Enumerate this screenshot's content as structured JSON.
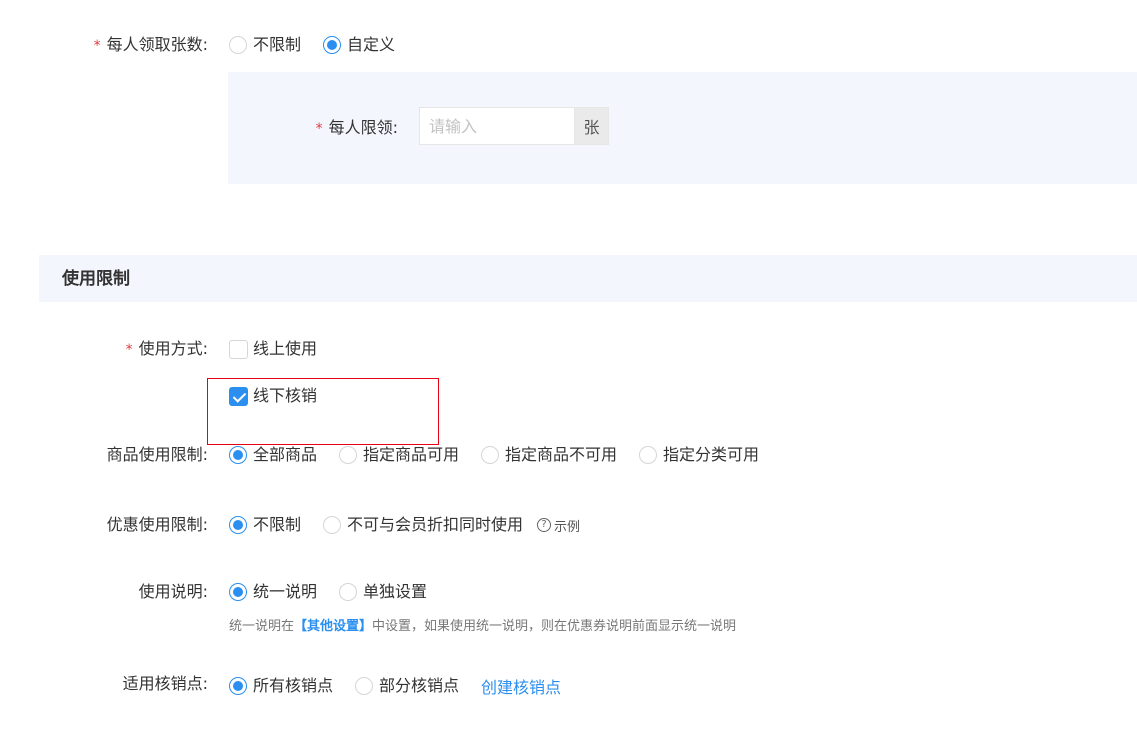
{
  "per_person_count": {
    "label": "每人领取张数:",
    "options": [
      {
        "label": "不限制",
        "checked": false
      },
      {
        "label": "自定义",
        "checked": true
      }
    ]
  },
  "per_person_limit": {
    "label": "每人限领:",
    "placeholder": "请输入",
    "value": "",
    "unit": "张"
  },
  "section_usage": {
    "title": "使用限制"
  },
  "usage_mode": {
    "label": "使用方式:",
    "options": [
      {
        "label": "线上使用",
        "checked": false
      },
      {
        "label": "线下核销",
        "checked": true
      }
    ]
  },
  "product_limit": {
    "label": "商品使用限制:",
    "options": [
      {
        "label": "全部商品",
        "checked": true
      },
      {
        "label": "指定商品可用",
        "checked": false
      },
      {
        "label": "指定商品不可用",
        "checked": false
      },
      {
        "label": "指定分类可用",
        "checked": false
      }
    ]
  },
  "discount_limit": {
    "label": "优惠使用限制:",
    "options": [
      {
        "label": "不限制",
        "checked": true
      },
      {
        "label": "不可与会员折扣同时使用",
        "checked": false
      }
    ],
    "help_label": "示例",
    "help_icon": "?"
  },
  "usage_desc": {
    "label": "使用说明:",
    "options": [
      {
        "label": "统一说明",
        "checked": true
      },
      {
        "label": "单独设置",
        "checked": false
      }
    ],
    "note_prefix": "统一说明在",
    "note_bold": "【其他设置】",
    "note_suffix": "中设置，如果使用统一说明，则在优惠券说明前面显示统一说明"
  },
  "verify_points": {
    "label": "适用核销点:",
    "options": [
      {
        "label": "所有核销点",
        "checked": true
      },
      {
        "label": "部分核销点",
        "checked": false
      }
    ],
    "create_link": "创建核销点"
  },
  "required_mark": "*",
  "colors": {
    "accent": "#2b8ff0",
    "required": "#e4393c",
    "highlight_border": "#e60012",
    "panel_bg": "#f3f6fd"
  }
}
